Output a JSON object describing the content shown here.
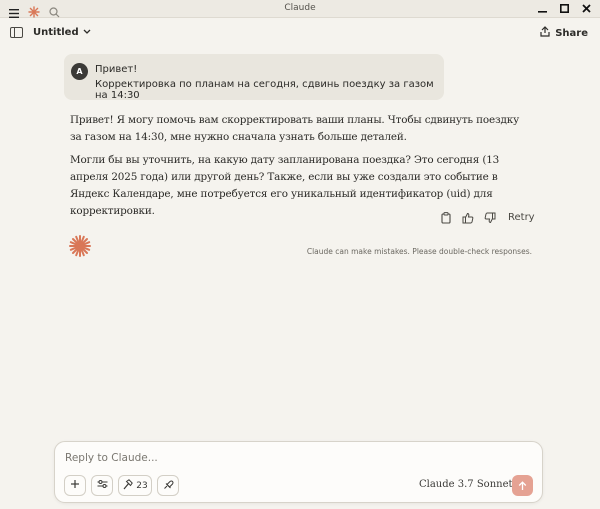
{
  "window": {
    "title": "Claude"
  },
  "header": {
    "doc_title": "Untitled",
    "share_label": "Share"
  },
  "conversation": {
    "user": {
      "avatar_initial": "A",
      "lines": [
        "Привет!",
        "Корректировка по планам на сегодня, сдвинь поездку за газом на 14:30"
      ]
    },
    "assistant": {
      "paragraphs": [
        "Привет! Я могу помочь вам скорректировать ваши планы. Чтобы сдвинуть поездку за газом на 14:30, мне нужно сначала узнать больше деталей.",
        "Могли бы вы уточнить, на какую дату запланирована поездка? Это сегодня (13 апреля 2025 года) или другой день? Также, если вы уже создали это событие в Яндекс Календаре, мне потребуется его уникальный идентификатор (uid) для корректировки."
      ]
    },
    "actions": {
      "retry_label": "Retry"
    },
    "disclaimer": "Claude can make mistakes. Please double-check responses."
  },
  "composer": {
    "placeholder": "Reply to Claude...",
    "tools_count": "23",
    "model_label": "Claude 3.7 Sonnet"
  },
  "icons": {
    "menu": "hamburger-icon",
    "logo": "claude-spark-icon",
    "search": "search-icon",
    "minimize": "minimize-icon",
    "maximize": "maximize-icon",
    "close": "close-icon",
    "sidebar": "sidebar-toggle-icon",
    "share": "share-icon",
    "copy": "copy-icon",
    "thumbs_up": "thumbs-up-icon",
    "thumbs_down": "thumbs-down-icon",
    "plus": "plus-icon",
    "sliders": "sliders-icon",
    "hammer": "hammer-icon",
    "integrations": "integrations-icon",
    "send": "arrow-up-icon"
  },
  "colors": {
    "accent": "#d97757",
    "send_bg": "#e5a293",
    "background": "#f5f3ee"
  }
}
